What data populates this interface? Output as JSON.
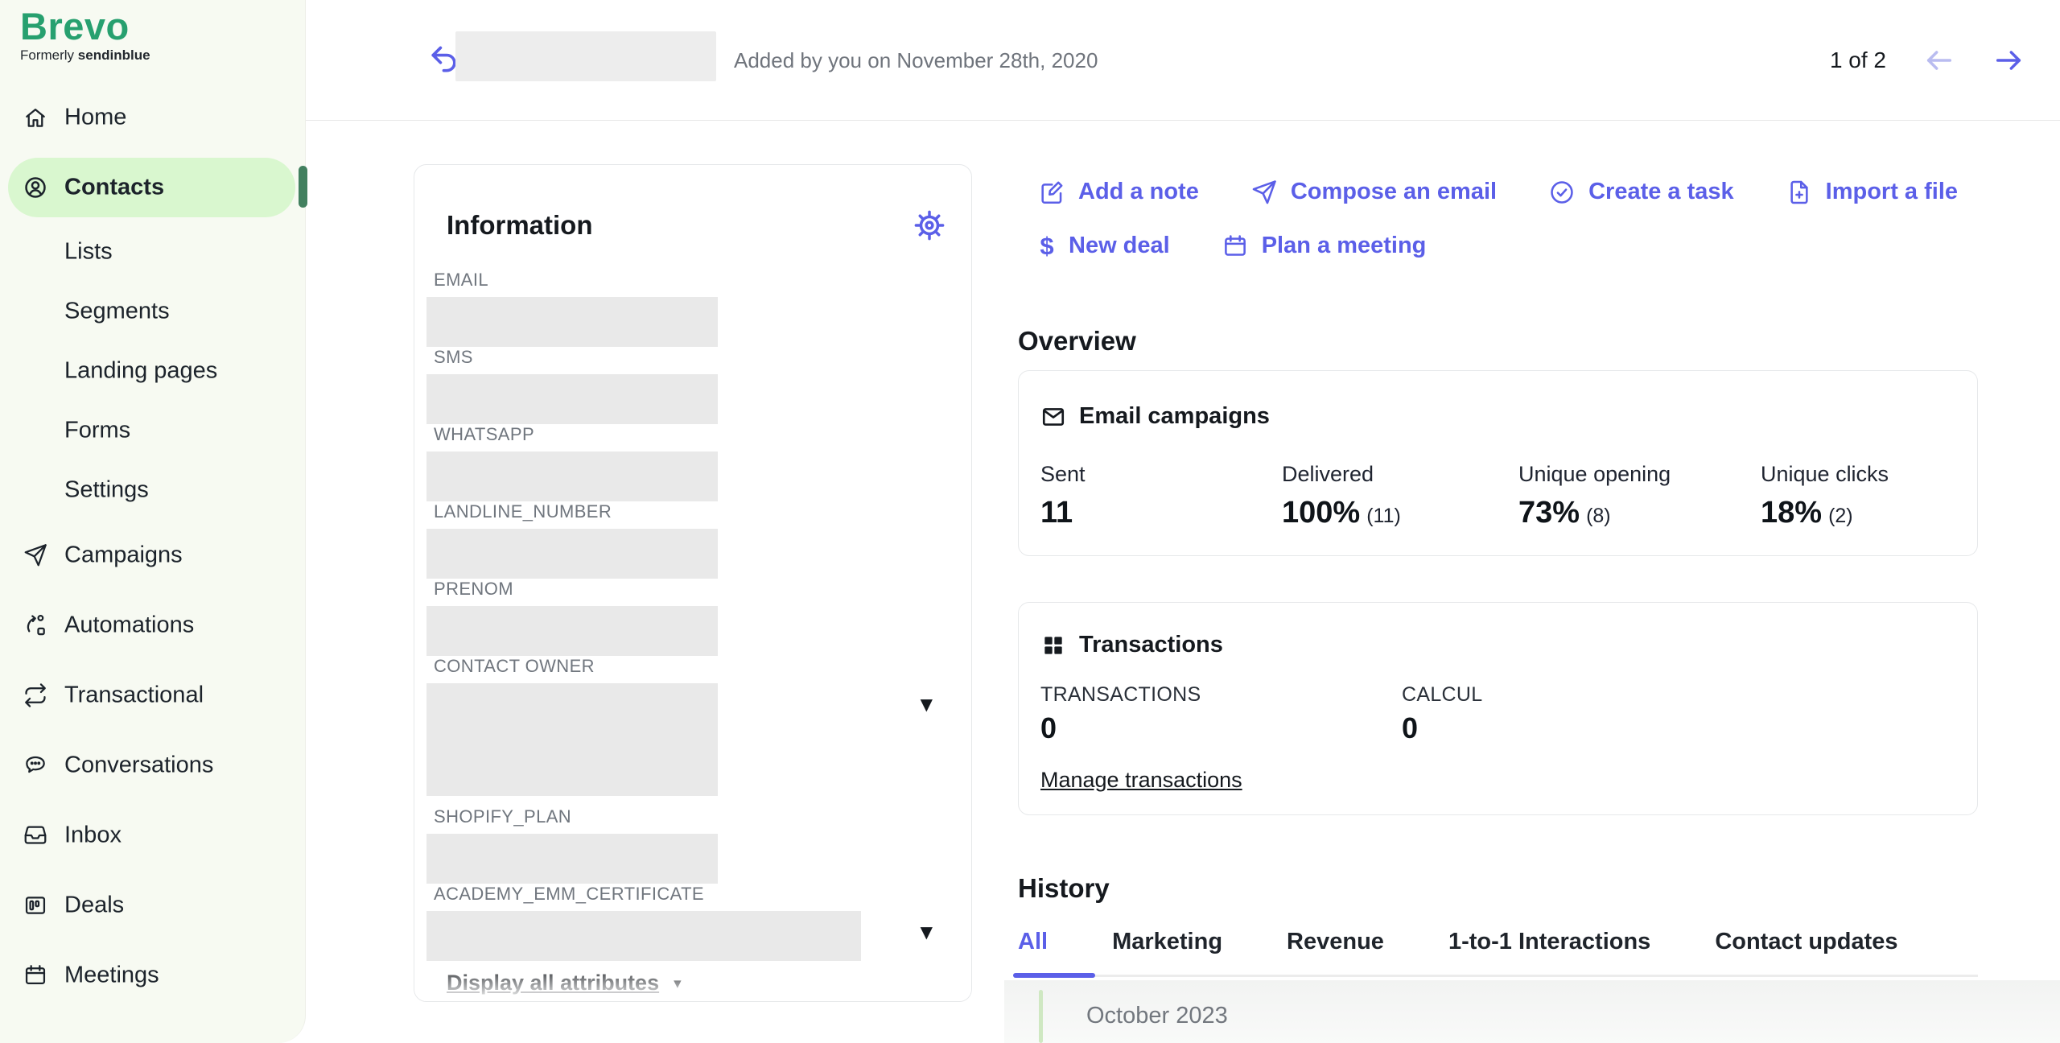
{
  "colors": {
    "accent_indigo": "#5b5fe8",
    "accent_indigo_disabled": "#b9bcf0",
    "brand_green": "#27a06f",
    "sidebar_bg": "#f7faf2",
    "active_pill": "#d9f7cf",
    "active_marker": "#42805f",
    "redacted_gray": "#e9e9e9",
    "timeline_green": "#cfe8c2"
  },
  "icons": {
    "caret_down": "▼",
    "caret_small": "▾",
    "dollar": "$"
  },
  "brand": {
    "name": "Brevo",
    "tagline_prefix": "Formerly",
    "tagline_brand": "sendinblue"
  },
  "sidebar": {
    "items": [
      {
        "label": "Home",
        "icon": "home-icon",
        "active": false
      },
      {
        "label": "Contacts",
        "icon": "contacts-icon",
        "active": true
      },
      {
        "label": "Lists",
        "active": false
      },
      {
        "label": "Segments",
        "active": false
      },
      {
        "label": "Landing pages",
        "active": false
      },
      {
        "label": "Forms",
        "active": false
      },
      {
        "label": "Settings",
        "active": false
      },
      {
        "label": "Campaigns",
        "icon": "paper-plane-icon",
        "active": false
      },
      {
        "label": "Automations",
        "icon": "automation-icon",
        "active": false
      },
      {
        "label": "Transactional",
        "icon": "repeat-icon",
        "active": false
      },
      {
        "label": "Conversations",
        "icon": "chat-icon",
        "active": false
      },
      {
        "label": "Inbox",
        "icon": "inbox-icon",
        "active": false
      },
      {
        "label": "Deals",
        "icon": "deals-icon",
        "active": false
      },
      {
        "label": "Meetings",
        "icon": "calendar-icon",
        "active": false
      }
    ]
  },
  "topbar": {
    "added_by": "Added by you on November 28th, 2020",
    "page_indicator": "1 of 2"
  },
  "information": {
    "title": "Information",
    "fields": [
      {
        "label": "EMAIL"
      },
      {
        "label": "SMS"
      },
      {
        "label": "WHATSAPP"
      },
      {
        "label": "LANDLINE_NUMBER"
      },
      {
        "label": "PRENOM"
      },
      {
        "label": "CONTACT OWNER",
        "dropdown": true
      },
      {
        "label": "SHOPIFY_PLAN"
      },
      {
        "label": "ACADEMY_EMM_CERTIFICATE",
        "dropdown": true
      }
    ],
    "display_all": "Display all attributes"
  },
  "actions": [
    {
      "label": "Add a note",
      "icon": "note-pencil-icon"
    },
    {
      "label": "Compose an email",
      "icon": "paper-plane-icon"
    },
    {
      "label": "Create a task",
      "icon": "check-circle-icon"
    },
    {
      "label": "Import a file",
      "icon": "file-plus-icon"
    },
    {
      "label": "New deal",
      "icon": "dollar-icon"
    },
    {
      "label": "Plan a meeting",
      "icon": "calendar-icon"
    }
  ],
  "overview": {
    "title": "Overview",
    "email_campaigns": {
      "title": "Email campaigns",
      "stats": [
        {
          "label": "Sent",
          "value": "11",
          "count": ""
        },
        {
          "label": "Delivered",
          "value": "100%",
          "count": "(11)"
        },
        {
          "label": "Unique opening",
          "value": "73%",
          "count": "(8)"
        },
        {
          "label": "Unique clicks",
          "value": "18%",
          "count": "(2)"
        }
      ]
    },
    "transactions": {
      "title": "Transactions",
      "metrics": [
        {
          "label": "TRANSACTIONS",
          "value": "0"
        },
        {
          "label": "CALCUL",
          "value": "0"
        }
      ],
      "manage_link": "Manage transactions"
    }
  },
  "history": {
    "title": "History",
    "tabs": [
      {
        "label": "All",
        "active": true
      },
      {
        "label": "Marketing",
        "active": false
      },
      {
        "label": "Revenue",
        "active": false
      },
      {
        "label": "1-to-1 Interactions",
        "active": false
      },
      {
        "label": "Contact updates",
        "active": false
      }
    ],
    "month_header": "October 2023"
  }
}
